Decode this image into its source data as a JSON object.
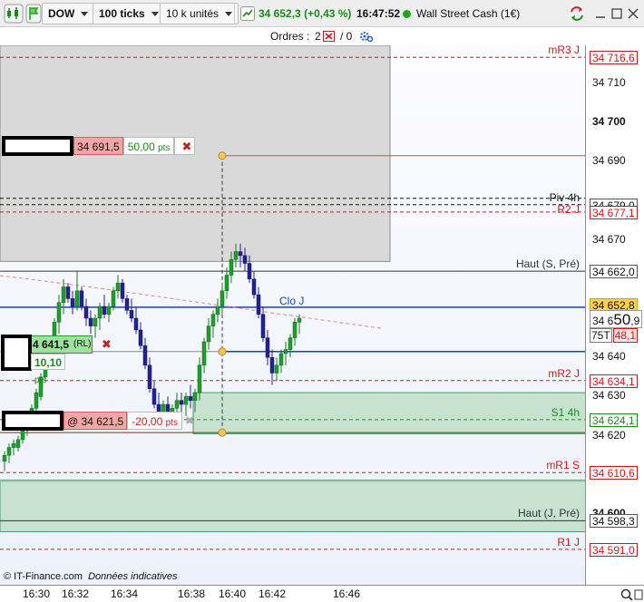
{
  "toolbar": {
    "symbol": "DOW",
    "period": "100 ticks",
    "units": "10 k unités",
    "price": "34 652,3",
    "change": "(+0,43 %)",
    "time": "16:47:52",
    "instrument": "Wall Street Cash (1€)"
  },
  "orders_bar": {
    "label": "Ordres :",
    "count": "2",
    "pending": "/ 0"
  },
  "levels": [
    {
      "label": "mR3 J",
      "value": "34 716,6",
      "y": 34716.6,
      "color": "#d01818",
      "style": "dashed"
    },
    {
      "label": "",
      "value": "",
      "y": 34691.5,
      "color": "#c0505a",
      "style": "solid"
    },
    {
      "label": "Piv 4h",
      "value": "34 679,0",
      "y": 34679.0,
      "color": "#111111",
      "style": "dashed"
    },
    {
      "label": "R2 J",
      "value": "34 677,1",
      "y": 34677.1,
      "color": "#d01818",
      "style": "dashed"
    },
    {
      "label": "Haut (S, Pré)",
      "value": "34 662,0",
      "y": 34662.0,
      "color": "#333333",
      "style": "solid"
    },
    {
      "label": "Clo J",
      "value": "",
      "y": 34652.8,
      "color": "#1a3fc0",
      "style": "solid"
    },
    {
      "label": "",
      "value": "",
      "y": 34641.5,
      "color": "#1a3fc0",
      "style": "solid"
    },
    {
      "label": "mR2 J",
      "value": "34 634,1",
      "y": 34634.1,
      "color": "#d01818",
      "style": "dashed"
    },
    {
      "label": "S1 4h",
      "value": "34 624,1",
      "y": 34624.1,
      "color": "#1a8a1a",
      "style": "dashed"
    },
    {
      "label": "mR1 S",
      "value": "34 610,6",
      "y": 34610.6,
      "color": "#d01818",
      "style": "dashed"
    },
    {
      "label": "Haut (J, Pré)",
      "value": "34 598,3",
      "y": 34598.3,
      "color": "#333333",
      "style": "solid"
    },
    {
      "label": "R1 J",
      "value": "34 591,0",
      "y": 34591.0,
      "color": "#d01818",
      "style": "dashed"
    }
  ],
  "yaxis": {
    "ticks": [
      "34 710",
      "34 700",
      "34 690",
      "34 670",
      "34 640",
      "34 630",
      "34 620",
      "34 600"
    ],
    "tick_values": [
      34710,
      34700,
      34690,
      34670,
      34640,
      34630,
      34620,
      34600
    ],
    "major": [
      34700,
      34600
    ],
    "current_prefix": "34 6",
    "current_big": "50",
    "current_suffix": ",9",
    "clo_value": "34 652,8",
    "timer": "75T",
    "ask_suffix": "48,1"
  },
  "orders": {
    "stop": {
      "price": "34 691,5",
      "pts": "50,00",
      "unit": "pts"
    },
    "entry": {
      "price": "4 641,5",
      "tag": "(RL)",
      "pts": "10,10",
      "unit": "pts"
    },
    "limit": {
      "price": "@ 34 621,5",
      "pts": "-20,00",
      "unit": "pts"
    }
  },
  "xaxis": {
    "labels": [
      "16:30",
      "16:32",
      "16:34",
      "16:38",
      "16:40",
      "16:42",
      "16:46"
    ]
  },
  "footer": {
    "copyright": "© IT-Finance.com",
    "note": "Données indicatives"
  },
  "colors": {
    "up": "#1f9e2a",
    "down": "#23238c",
    "up_alt": "#36b33a",
    "background_top": "#fcfcff",
    "background_bottom": "#eef1fb"
  }
}
